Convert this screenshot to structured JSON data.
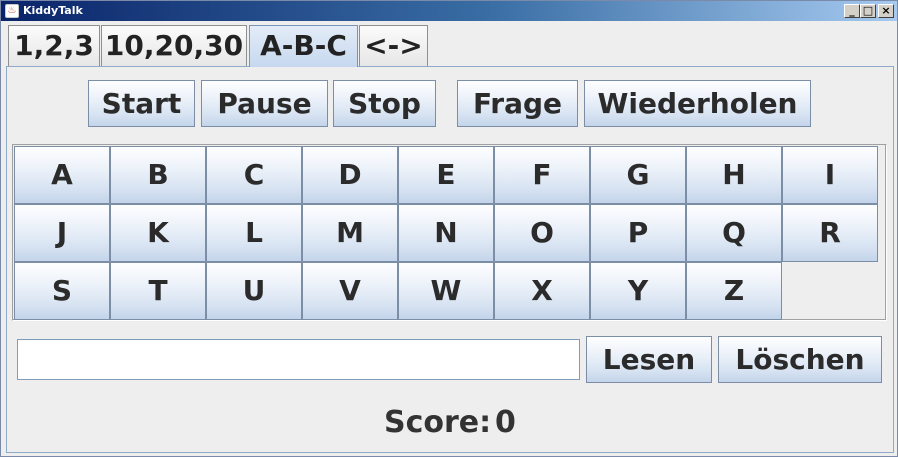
{
  "window": {
    "title": "KiddyTalk",
    "controls": {
      "minimize": "_",
      "maximize": "□",
      "close": "×"
    }
  },
  "tabs": [
    {
      "label": "1,2,3",
      "selected": false
    },
    {
      "label": "10,20,30",
      "selected": false
    },
    {
      "label": "A-B-C",
      "selected": true
    },
    {
      "label": "<->",
      "selected": false
    }
  ],
  "controls": {
    "start": "Start",
    "pause": "Pause",
    "stop": "Stop",
    "question": "Frage",
    "repeat": "Wiederholen"
  },
  "letters": [
    "A",
    "B",
    "C",
    "D",
    "E",
    "F",
    "G",
    "H",
    "I",
    "J",
    "K",
    "L",
    "M",
    "N",
    "O",
    "P",
    "Q",
    "R",
    "S",
    "T",
    "U",
    "V",
    "W",
    "X",
    "Y",
    "Z"
  ],
  "input": {
    "value": "",
    "placeholder": ""
  },
  "actions": {
    "read": "Lesen",
    "clear": "Löschen"
  },
  "score": {
    "label": "Score:",
    "value": "0"
  },
  "colors": {
    "title_start": "#0a246a",
    "title_end": "#a6caf0",
    "button_top": "#fdfeff",
    "button_bottom": "#c3d4ea",
    "selected_tab": "#c6d8ef"
  },
  "icons": {
    "app": "java-cup-icon"
  }
}
